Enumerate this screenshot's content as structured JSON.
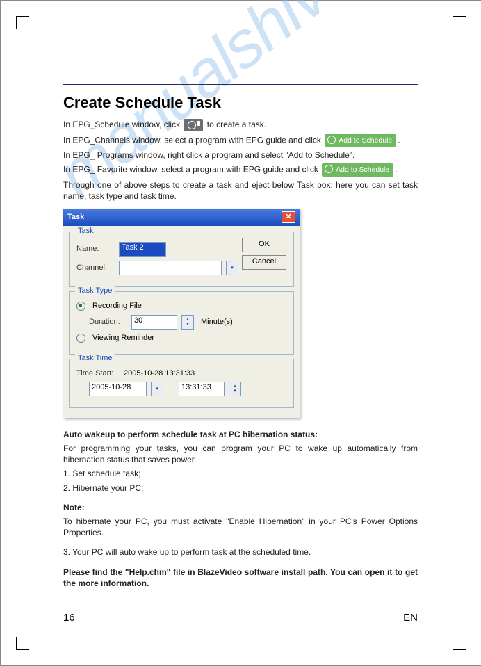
{
  "watermark": "manualshive.com",
  "title": "Create Schedule Task",
  "p1a": "In EPG_Schedule window, click ",
  "p1b": " to create a task.",
  "p2a": "In EPG_Channels window, select a program with EPG guide and click ",
  "p2end": ".",
  "p3": "In EPG_ Programs window, right click a program and select \"Add to Schedule\".",
  "p4a": "In EPG_ Favorite window, select a program with EPG guide and click ",
  "p4end": ".",
  "p5": "Through one of above steps to create a task and eject below Task box: here you can set task name, task type and task time.",
  "addBtn": "Add to Schedule",
  "win": {
    "title": "Task",
    "ok": "OK",
    "cancel": "Cancel",
    "g1": "Task",
    "name_lbl": "Name:",
    "name_val": "Task 2",
    "channel_lbl": "Channel:",
    "channel_val": "",
    "g2": "Task Type",
    "rec": "Recording File",
    "dur_lbl": "Duration:",
    "dur_val": "30",
    "dur_unit": "Minute(s)",
    "view": "Viewing Reminder",
    "g3": "Task Time",
    "ts_lbl": "Time Start:",
    "ts_val": "2005-10-28 13:31:33",
    "date_val": "2005-10-28",
    "time_val": "13:31:33"
  },
  "s1": "Auto wakeup to perform schedule task at PC hibernation status:",
  "s2": "For programming your tasks, you can program your PC to wake up automatically from hibernation status that saves power.",
  "s3": "1. Set schedule task;",
  "s4": "2. Hibernate your PC;",
  "s5": "Note:",
  "s6": "To hibernate your PC, you must activate \"Enable Hibernation\" in your PC's Power Options Properties.",
  "s7": "3. Your PC will auto wake up to perform task at the scheduled time.",
  "s8": "Please find the \"Help.chm\" file in BlazeVideo software install path. You can open it to get the more information.",
  "pg": "16",
  "lang": "EN"
}
